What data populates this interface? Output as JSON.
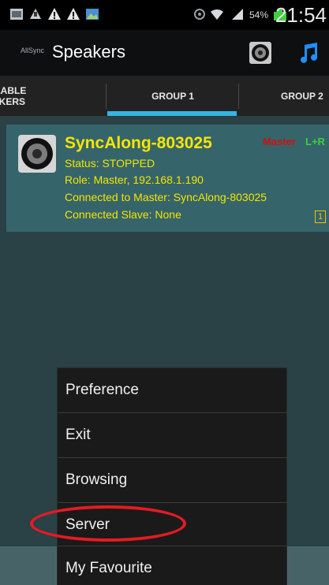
{
  "status_bar": {
    "battery_percent": "54%",
    "time": "21:54"
  },
  "action_bar": {
    "logo_text": "AllSync",
    "title": "Speakers"
  },
  "tabs": [
    {
      "label_line1": "ILABLE",
      "label_line2": "AKERS"
    },
    {
      "label": "GROUP 1"
    },
    {
      "label": "GROUP 2"
    }
  ],
  "speaker": {
    "name": "SyncAlong-803025",
    "status": "Status: STOPPED",
    "role": "Role: Master,  192.168.1.190",
    "connected": "Connected to Master: SyncAlong-803025",
    "slave": "Connected Slave: None",
    "master_tag": "Master",
    "channel_tag": "L+R",
    "count": "1"
  },
  "menu": {
    "items": [
      "Preference",
      "Exit",
      "Browsing",
      "Server",
      "My Favourite"
    ]
  },
  "colors": {
    "accent": "#33b5e5",
    "speaker_text": "#f2e600",
    "master_tag": "#d01010",
    "channel_tag": "#3bcf3b",
    "highlight": "#e41b23"
  }
}
